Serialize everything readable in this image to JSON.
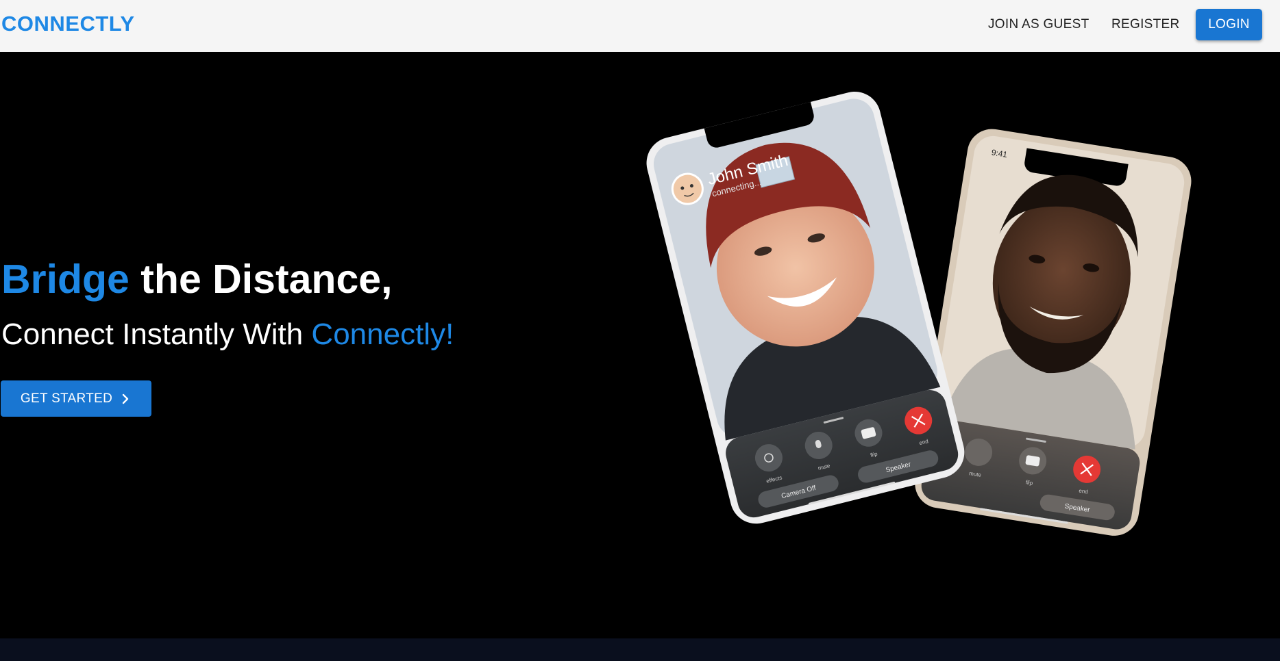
{
  "navbar": {
    "brand": "CONNECTLY",
    "links": [
      "JOIN AS GUEST",
      "REGISTER"
    ],
    "login_label": "LOGIN"
  },
  "hero": {
    "heading_accent": "Bridge",
    "heading_rest": " the Distance,",
    "subheading_prefix": "Connect Instantly With ",
    "subheading_accent": "Connectly!",
    "cta_label": "GET STARTED"
  },
  "phones": {
    "front": {
      "caller_name": "John Smith",
      "caller_status": "connecting...",
      "controls": [
        "effects",
        "mute",
        "flip",
        "end"
      ],
      "camera_off_label": "Camera Off",
      "speaker_label": "Speaker"
    },
    "back": {
      "time": "9:41",
      "controls": [
        "mute",
        "flip",
        "end"
      ],
      "speaker_label": "Speaker"
    }
  },
  "colors": {
    "accent": "#1e88e5",
    "button": "#1976d2",
    "navbar_bg": "#f5f5f5",
    "hero_bg": "#000000",
    "end_call": "#e53935"
  }
}
